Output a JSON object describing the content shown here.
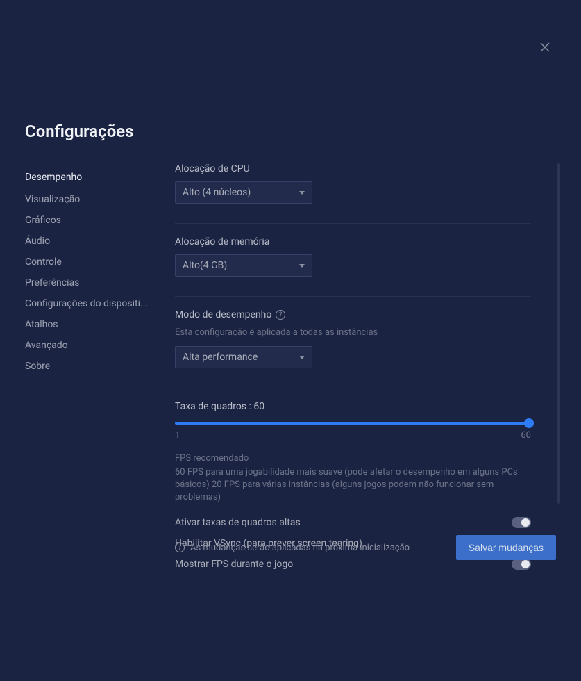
{
  "title": "Configurações",
  "sidebar": {
    "items": [
      {
        "label": "Desempenho",
        "active": true
      },
      {
        "label": "Visualização",
        "active": false
      },
      {
        "label": "Gráficos",
        "active": false
      },
      {
        "label": "Áudio",
        "active": false
      },
      {
        "label": "Controle",
        "active": false
      },
      {
        "label": "Preferências",
        "active": false
      },
      {
        "label": "Configurações do dispositi...",
        "active": false
      },
      {
        "label": "Atalhos",
        "active": false
      },
      {
        "label": "Avançado",
        "active": false
      },
      {
        "label": "Sobre",
        "active": false
      }
    ]
  },
  "cpu": {
    "label": "Alocação de CPU",
    "value": "Alto (4 núcleos)"
  },
  "memory": {
    "label": "Alocação de memória",
    "value": "Alto(4 GB)"
  },
  "performance": {
    "label": "Modo de desempenho",
    "sublabel": "Esta configuração é aplicada a todas as instâncias",
    "value": "Alta performance"
  },
  "framerate": {
    "label": "Taxa de quadros : 60",
    "min": "1",
    "max": "60",
    "rec_title": "FPS recomendado",
    "rec_desc": "60 FPS para uma jogabilidade mais suave (pode afetar o desempenho em alguns PCs básicos) 20 FPS para várias instâncias (alguns jogos podem não funcionar sem problemas)"
  },
  "toggles": {
    "high_fps": "Ativar taxas de quadros altas",
    "vsync": "Habilitar VSync (para prever screen tearing)",
    "show_fps": "Mostrar FPS durante o jogo"
  },
  "footer": {
    "info": "As mudanças serão aplicadas na próxima inicialização",
    "save": "Salvar mudanças"
  }
}
